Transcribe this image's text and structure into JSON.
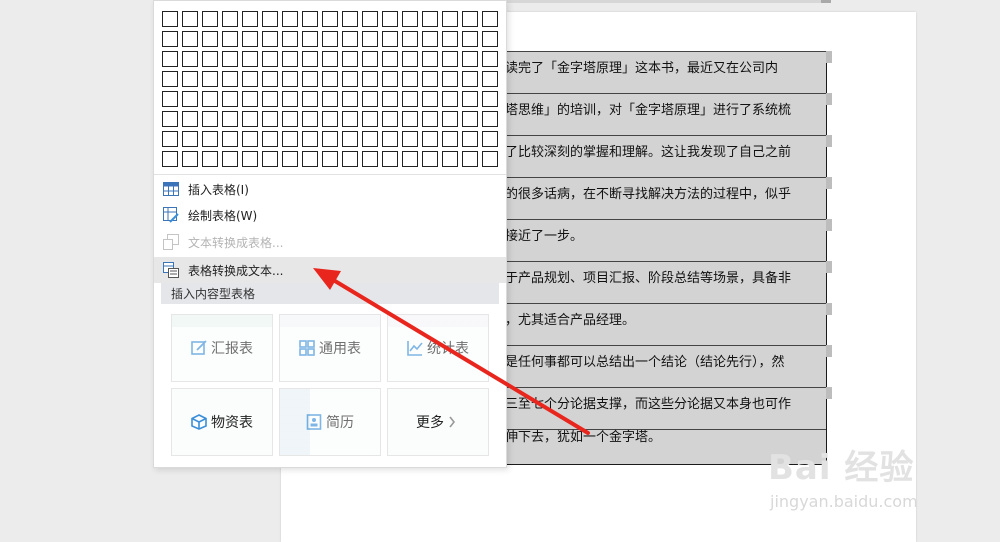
{
  "document": {
    "lines": [
      "读完了「金字塔原理」这本书，最近又在公司内",
      "塔思维」的培训，对「金字塔原理」进行了系统梳",
      "了比较深刻的掌握和理解。这让我发现了自己之前",
      "的很多话病，在不断寻找解决方法的过程中，似乎",
      "接近了一步。",
      "于产品规划、项目汇报、阶段总结等场景，具备非",
      "，尤其适合产品经理。",
      "是任何事都可以总结出一个结论（结论先行），然",
      "三至七个分论据支撑，而这些分论据又本身也可作",
      "伸下去，犹如一个金字塔。"
    ]
  },
  "dropdown": {
    "grid_rows": 8,
    "grid_cols": 17,
    "menu": [
      {
        "label": "插入表格(I)",
        "icon": "table-icon",
        "state": "normal"
      },
      {
        "label": "绘制表格(W)",
        "icon": "draw-table-icon",
        "state": "normal"
      },
      {
        "label": "文本转换成表格...",
        "icon": "text-to-table-icon",
        "state": "disabled"
      },
      {
        "label": "表格转换成文本...",
        "icon": "table-to-text-icon",
        "state": "active"
      }
    ],
    "section_label": "插入内容型表格",
    "templates": [
      {
        "label": "汇报表",
        "icon": "report-icon"
      },
      {
        "label": "通用表",
        "icon": "grid-icon"
      },
      {
        "label": "统计表",
        "icon": "chart-line-icon"
      },
      {
        "label": "物资表",
        "icon": "box-icon"
      },
      {
        "label": "简历",
        "icon": "resume-icon"
      },
      {
        "label": "更多",
        "icon": "chevron-right-icon"
      }
    ]
  },
  "watermark": {
    "brand": "Bai 经验",
    "url": "jingyan.baidu.com"
  },
  "colors": {
    "accent_blue": "#3b8fd8",
    "arrow_red": "#e8261e",
    "table_fill": "#d3d3d3"
  }
}
